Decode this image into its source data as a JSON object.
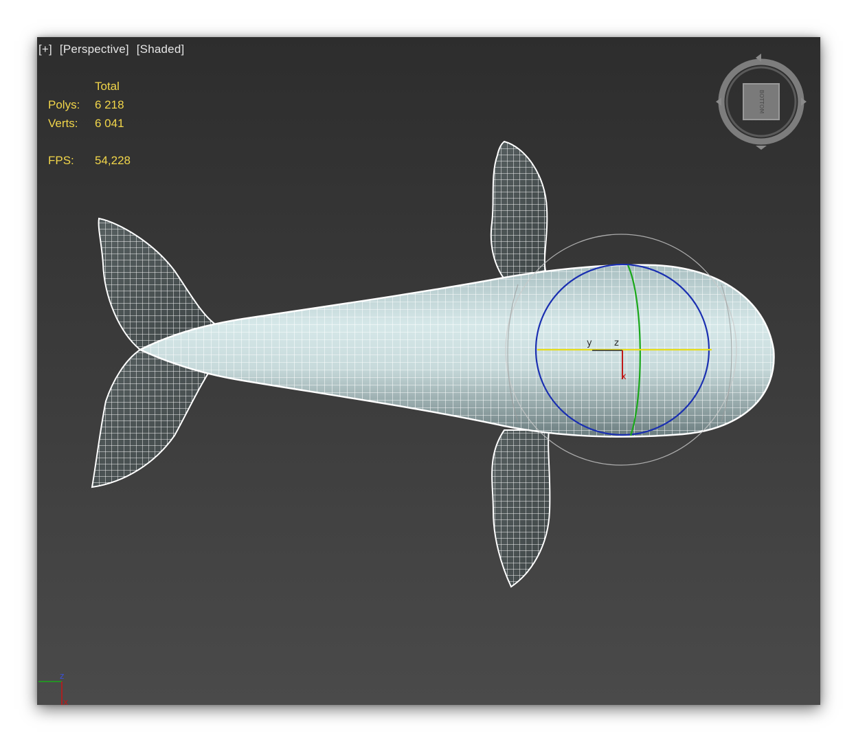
{
  "viewport": {
    "labels": [
      "[+]",
      "[Perspective]",
      "[Shaded]"
    ]
  },
  "stats": {
    "header": "Total",
    "polys_label": "Polys:",
    "polys_value": "6 218",
    "verts_label": "Verts:",
    "verts_value": "6 041",
    "fps_label": "FPS:",
    "fps_value": "54,228"
  },
  "gizmo": {
    "y_label": "y",
    "z_label": "z",
    "x_label": "x"
  },
  "viewcube": {
    "face_label": "BOTTOM"
  },
  "tripod": {
    "z_label": "z",
    "x_label": "x"
  },
  "colors": {
    "stats_text": "#f2d64a",
    "wire": "#ffffff",
    "body": "#cfe3e4",
    "gizmo_blue": "#1a2fb0",
    "gizmo_green": "#1aa81a",
    "gizmo_yellow": "#e6dc1a",
    "gizmo_red": "#c01818"
  }
}
